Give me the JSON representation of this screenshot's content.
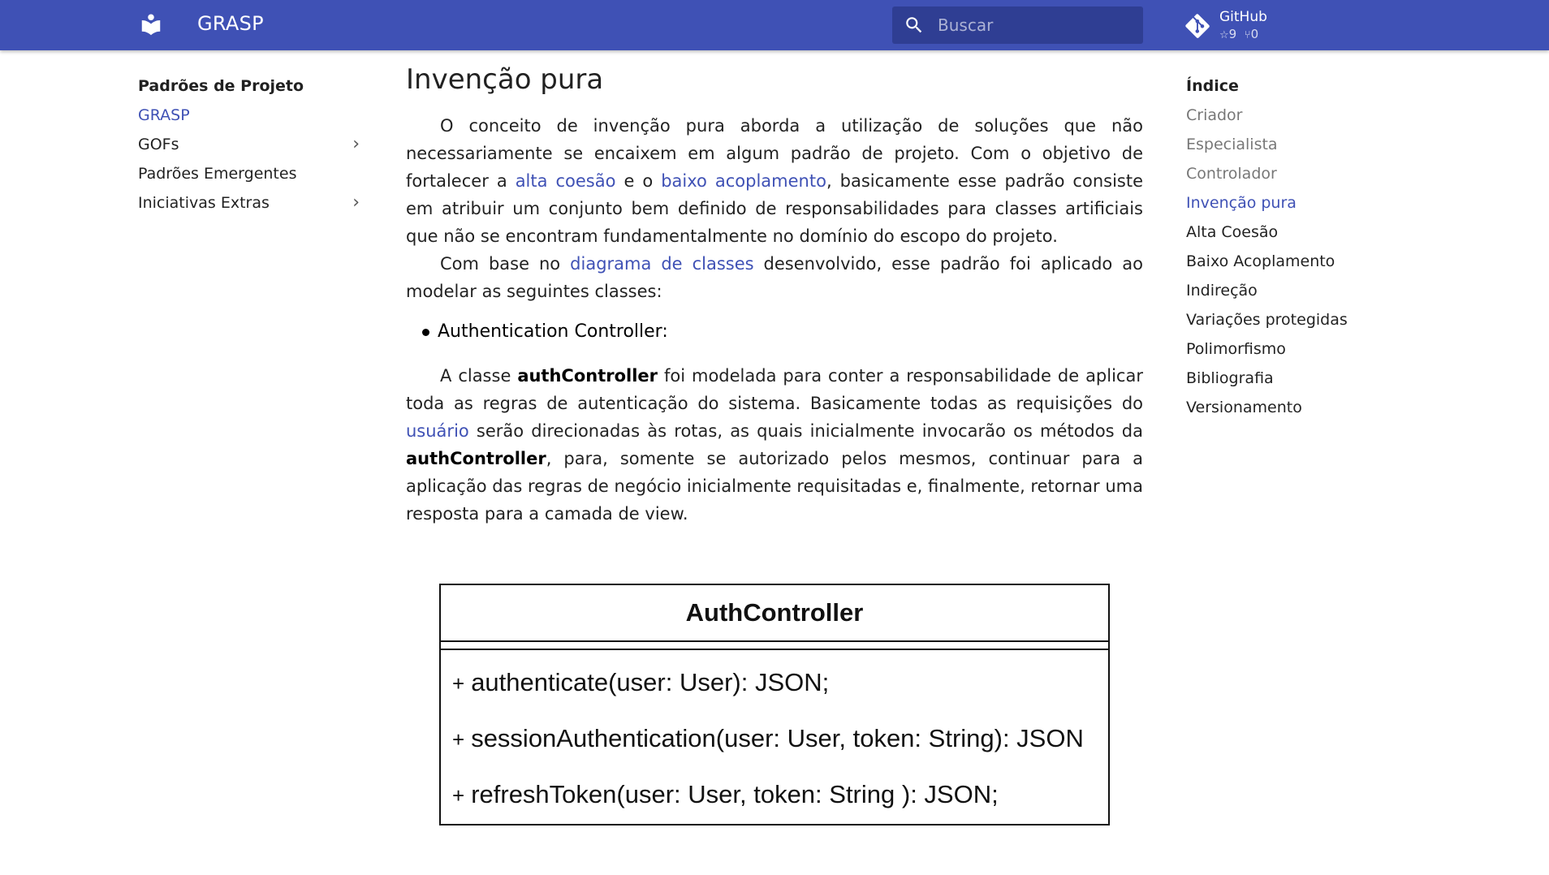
{
  "header": {
    "title": "GRASP",
    "search_placeholder": "Buscar",
    "repo": {
      "name": "GitHub",
      "stars": "9",
      "forks": "0"
    },
    "colors": {
      "primary": "#3f51b5",
      "search_bg": "#2f3e93"
    }
  },
  "nav": {
    "title": "Padrões de Projeto",
    "items": [
      {
        "label": "GRASP",
        "active": true,
        "expandable": false
      },
      {
        "label": "GOFs",
        "active": false,
        "expandable": true
      },
      {
        "label": "Padrões Emergentes",
        "active": false,
        "expandable": false
      },
      {
        "label": "Iniciativas Extras",
        "active": false,
        "expandable": true
      }
    ]
  },
  "content": {
    "title": "Invenção pura",
    "p1": {
      "a": "O conceito de invenção pura aborda a utilização de soluções que não necessariamente se encaixem em algum padrão de projeto. Com o objetivo de fortalecer a ",
      "link1": "alta coesão",
      "b": " e o ",
      "link2": "baixo acoplamento",
      "c": ", basicamente esse padrão consiste em atribuir um conjunto bem definido de responsabilidades para classes artificiais que não se encontram fundamentalmente no domínio do escopo do projeto."
    },
    "p2": {
      "a": "Com base no ",
      "link": "diagrama de classes",
      "b": " desenvolvido, esse padrão foi aplicado ao modelar as seguintes classes:"
    },
    "bullet": "Authentication Controller:",
    "p3": {
      "a": "A classe ",
      "strong1": "authController",
      "b": " foi modelada para conter a responsabilidade de aplicar toda as regras de autenticação do sistema. Basicamente todas as requisições do ",
      "link": "usuário",
      "c": " serão direcionadas às rotas, as quais inicialmente invocarão os métodos da ",
      "strong2": "authController",
      "d": ", para, somente se autorizado pelos mesmos, continuar para a aplicação das regras de negócio inicialmente requisitadas e, finalmente, retornar uma resposta para a camada de view."
    },
    "uml": {
      "class_name": "AuthController",
      "methods": [
        {
          "visibility": "+",
          "signature": "authenticate(user: User): JSON;"
        },
        {
          "visibility": "+",
          "signature": "sessionAuthentication(user: User, token: String): JSON"
        },
        {
          "visibility": "+",
          "signature": "refreshToken(user: User, token: String ): JSON;"
        }
      ]
    }
  },
  "toc": {
    "title": "Índice",
    "items": [
      {
        "label": "Criador",
        "state": "muted"
      },
      {
        "label": "Especialista",
        "state": "muted"
      },
      {
        "label": "Controlador",
        "state": "muted"
      },
      {
        "label": "Invenção pura",
        "state": "active"
      },
      {
        "label": "Alta Coesão",
        "state": "normal"
      },
      {
        "label": "Baixo Acoplamento",
        "state": "normal"
      },
      {
        "label": "Indireção",
        "state": "normal"
      },
      {
        "label": "Variações protegidas",
        "state": "normal"
      },
      {
        "label": "Polimorfismo",
        "state": "normal"
      },
      {
        "label": "Bibliografia",
        "state": "normal"
      },
      {
        "label": "Versionamento",
        "state": "normal"
      }
    ]
  }
}
